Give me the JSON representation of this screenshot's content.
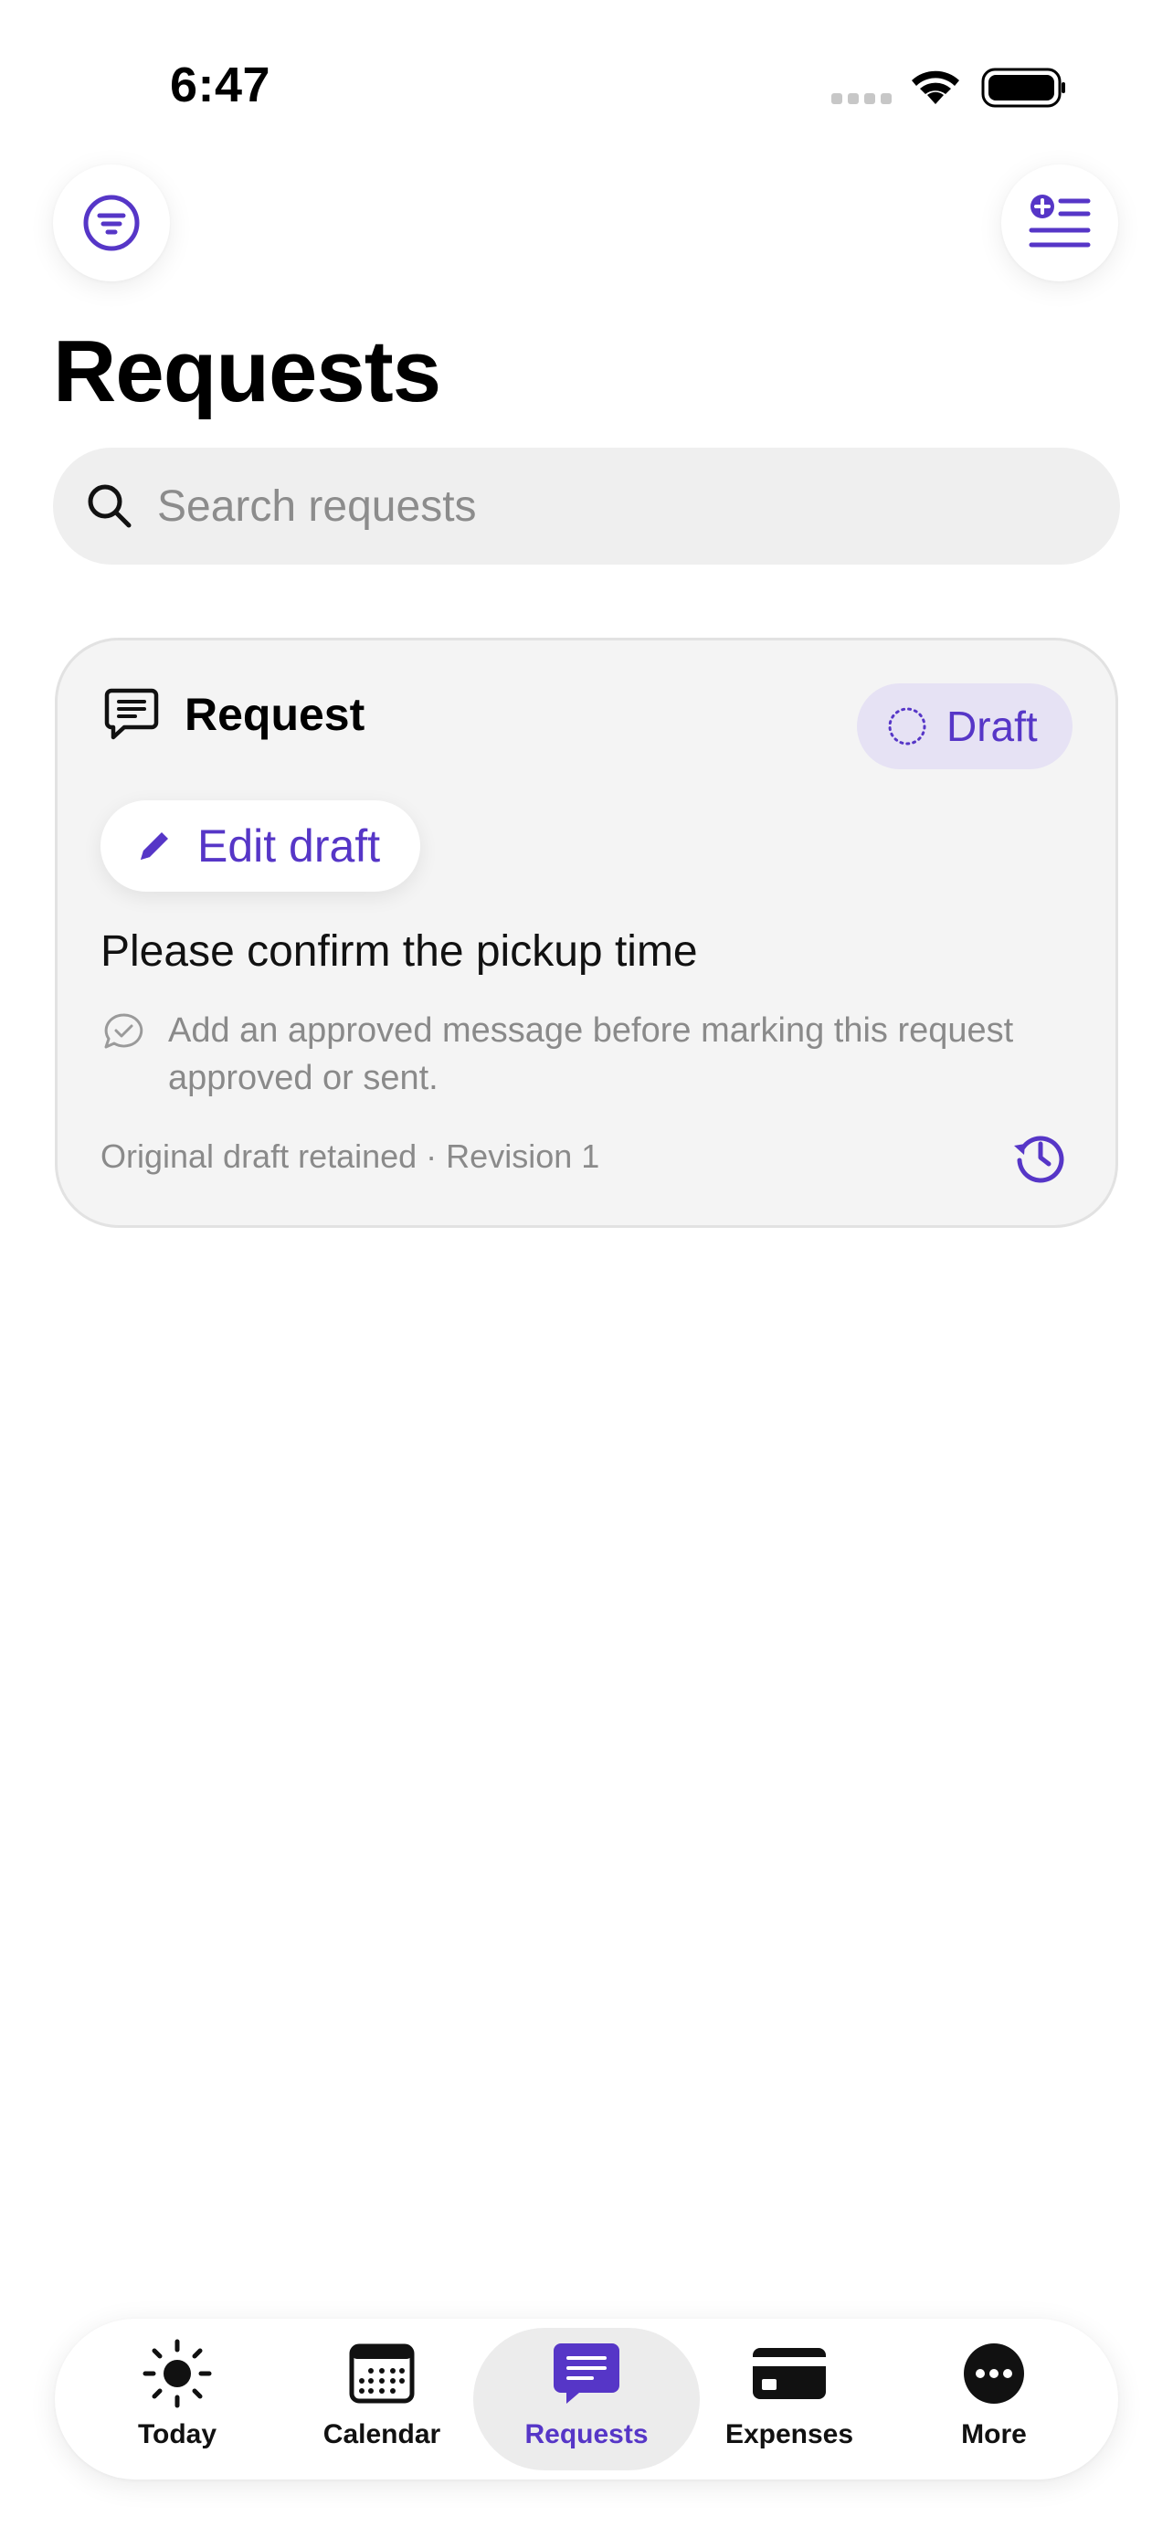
{
  "status_bar": {
    "time": "6:47"
  },
  "header": {
    "title": "Requests"
  },
  "search": {
    "placeholder": "Search requests",
    "value": ""
  },
  "card": {
    "title": "Request",
    "badge": "Draft",
    "edit_label": "Edit draft",
    "message": "Please confirm the pickup time",
    "hint": "Add an approved message before marking this request approved or sent.",
    "footer": "Original draft retained · Revision 1"
  },
  "tabs": [
    {
      "label": "Today",
      "icon": "sun-icon",
      "active": false
    },
    {
      "label": "Calendar",
      "icon": "calendar-icon",
      "active": false
    },
    {
      "label": "Requests",
      "icon": "message-bubble-icon",
      "active": true
    },
    {
      "label": "Expenses",
      "icon": "credit-card-icon",
      "active": false
    },
    {
      "label": "More",
      "icon": "more-icon",
      "active": false
    }
  ],
  "colors": {
    "accent": "#5636c7",
    "badge_bg": "#e6e2f4",
    "card_bg": "#f4f4f4",
    "search_bg": "#efefef"
  }
}
